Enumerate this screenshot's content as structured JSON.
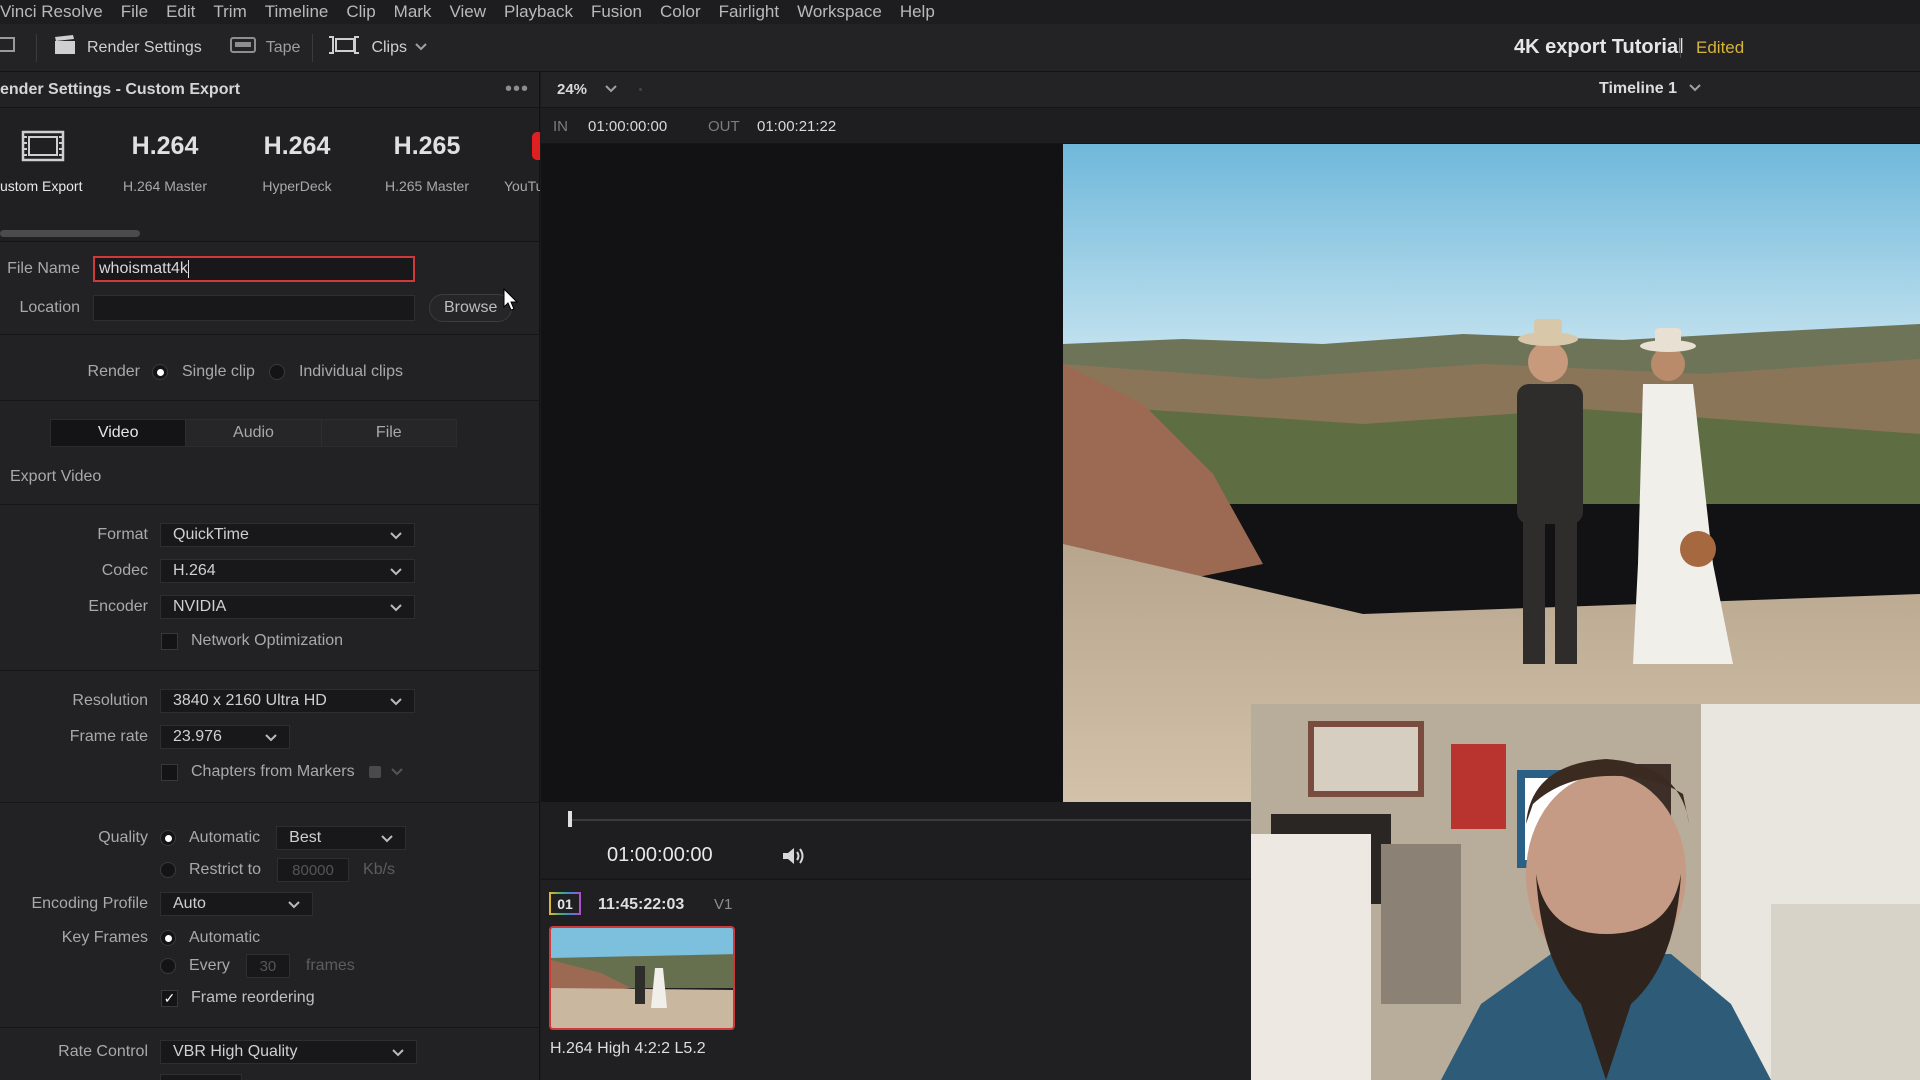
{
  "menu": {
    "items": [
      "Vinci Resolve",
      "File",
      "Edit",
      "Trim",
      "Timeline",
      "Clip",
      "Mark",
      "View",
      "Playback",
      "Fusion",
      "Color",
      "Fairlight",
      "Workspace",
      "Help"
    ]
  },
  "toolbar": {
    "render_settings": "Render Settings",
    "tape": "Tape",
    "clips": "Clips",
    "project_title": "4K export Tutorial",
    "project_status": "Edited"
  },
  "render_panel": {
    "title": "ender Settings - Custom Export",
    "more": "•••",
    "presets": [
      {
        "big": "",
        "label": "ustom Export"
      },
      {
        "big": "H.264",
        "label": "H.264 Master"
      },
      {
        "big": "H.264",
        "label": "HyperDeck"
      },
      {
        "big": "H.265",
        "label": "H.265 Master"
      },
      {
        "big": "",
        "label": "YouTu"
      }
    ],
    "file_name_label": "File Name",
    "file_name_value": "whoismatt4k",
    "location_label": "Location",
    "location_value": "",
    "browse": "Browse",
    "render_label": "Render",
    "single_clip": "Single clip",
    "individual_clips": "Individual clips",
    "tabs": [
      "Video",
      "Audio",
      "File"
    ],
    "export_video": "Export Video",
    "format_label": "Format",
    "format_value": "QuickTime",
    "codec_label": "Codec",
    "codec_value": "H.264",
    "encoder_label": "Encoder",
    "encoder_value": "NVIDIA",
    "network_opt": "Network Optimization",
    "resolution_label": "Resolution",
    "resolution_value": "3840 x 2160 Ultra HD",
    "frame_rate_label": "Frame rate",
    "frame_rate_value": "23.976",
    "chapters": "Chapters from Markers",
    "quality_label": "Quality",
    "quality_auto": "Automatic",
    "quality_value": "Best",
    "restrict_to": "Restrict to",
    "restrict_value": "80000",
    "restrict_unit": "Kb/s",
    "encoding_profile_label": "Encoding Profile",
    "encoding_profile_value": "Auto",
    "key_frames_label": "Key Frames",
    "key_frames_auto": "Automatic",
    "every": "Every",
    "every_value": "30",
    "frames": "frames",
    "frame_reordering": "Frame reordering",
    "rate_control_label": "Rate Control",
    "rate_control_value": "VBR High Quality"
  },
  "viewer": {
    "zoom": "24%",
    "timeline_name": "Timeline 1",
    "in_label": "IN",
    "in_tc": "01:00:00:00",
    "out_label": "OUT",
    "out_tc": "01:00:21:22",
    "playhead_tc": "01:00:00:00"
  },
  "clip": {
    "badge": "01",
    "timecode": "11:45:22:03",
    "track": "V1",
    "codec": "H.264 High 4:2:2 L5.2"
  },
  "colors": {
    "accent_red": "#d0393a",
    "edited_yellow": "#d6b43a"
  }
}
